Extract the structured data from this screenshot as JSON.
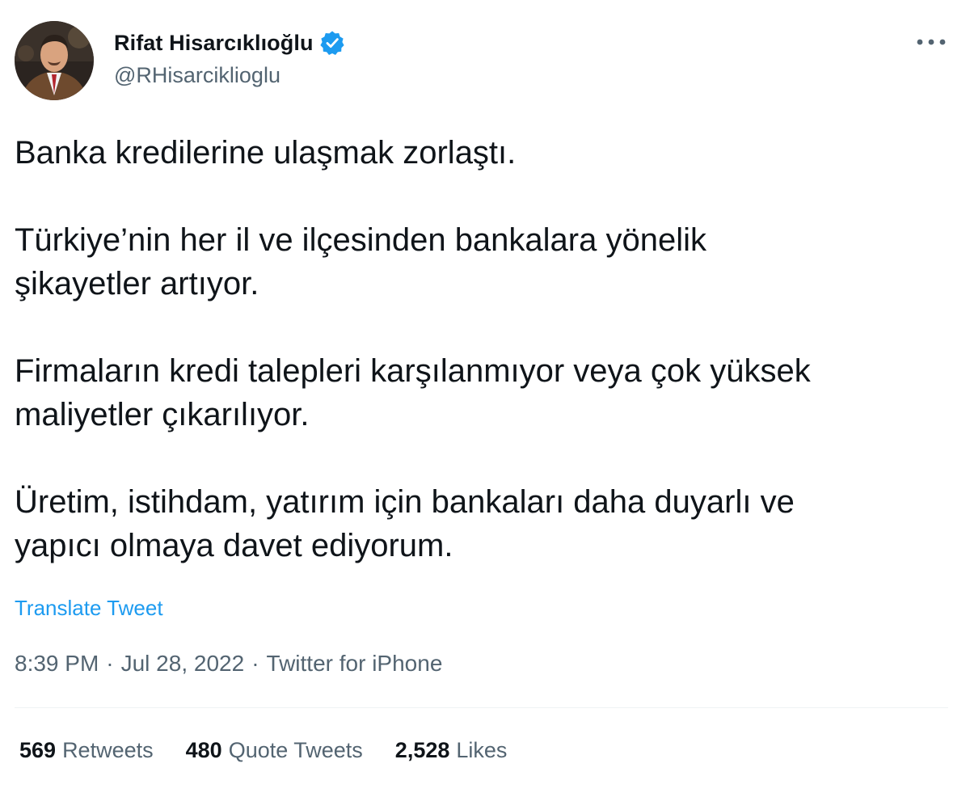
{
  "author": {
    "display_name": "Rifat Hisarcıklıoğlu",
    "handle": "@RHisarciklioglu",
    "verified": true,
    "avatar_icon": "profile-photo"
  },
  "tweet": {
    "paragraphs": [
      "Banka kredilerine ulaşmak zorlaştı.",
      "Türkiye’nin her il ve ilçesinden bankalara yönelik\nşikayetler artıyor.",
      "Firmaların kredi talepleri karşılanmıyor veya çok yüksek\nmaliyetler çıkarılıyor.",
      "Üretim, istihdam, yatırım için bankaları daha duyarlı ve\nyapıcı olmaya davet ediyorum."
    ],
    "translate_label": "Translate Tweet"
  },
  "meta": {
    "time": "8:39 PM",
    "sep": "·",
    "date": "Jul 28, 2022",
    "source": "Twitter for iPhone"
  },
  "stats": {
    "retweets_count": "569",
    "retweets_label": "Retweets",
    "quotes_count": "480",
    "quotes_label": "Quote Tweets",
    "likes_count": "2,528",
    "likes_label": "Likes"
  },
  "colors": {
    "accent": "#1d9bf0",
    "text_primary": "#0f1419",
    "text_secondary": "#536471",
    "divider": "#eff3f4"
  }
}
